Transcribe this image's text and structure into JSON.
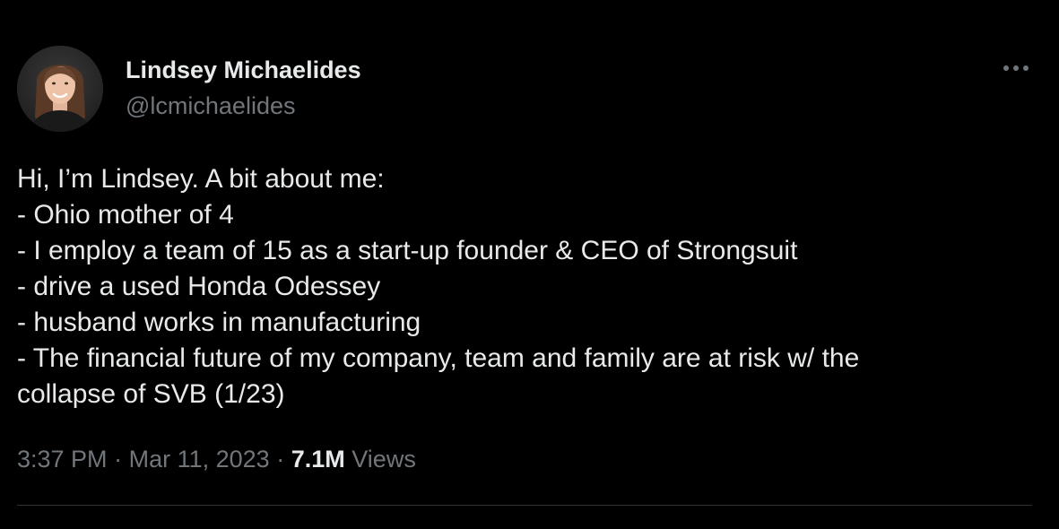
{
  "author": {
    "display_name": "Lindsey Michaelides",
    "handle": "@lcmichaelides"
  },
  "tweet": {
    "lines": [
      "Hi, I’m Lindsey. A bit about me:",
      "- Ohio mother of 4",
      "- I employ a team of 15 as a start-up founder & CEO of Strongsuit",
      "- drive a used Honda Odessey",
      "- husband works in manufacturing",
      "- The financial future of my company, team and family are at risk w/ the",
      "collapse of SVB (1/23)"
    ]
  },
  "meta": {
    "time": "3:37 PM",
    "separator": "·",
    "date": "Mar 11, 2023",
    "views_count": "7.1M",
    "views_label": "Views"
  },
  "icons": {
    "more": "more-horizontal-icon",
    "avatar": "profile-photo"
  },
  "colors": {
    "background": "#000000",
    "primary_text": "#e7e9ea",
    "secondary_text": "#71767b",
    "divider": "#2f3336"
  }
}
